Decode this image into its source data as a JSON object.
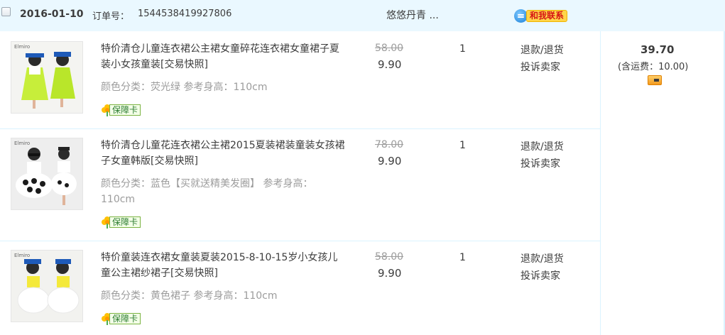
{
  "order": {
    "date": "2016-01-10",
    "order_no_label": "订单号：",
    "order_no": "1544538419927806",
    "shop_name": "悠悠丹青 ...",
    "contact_label": "和我联系",
    "total": "39.70",
    "shipping": "(含运费：10.00)"
  },
  "items": [
    {
      "title": "特价清仓儿童连衣裙公主裙女童碎花连衣裙女童裙子夏装小女孩童装[交易快照]",
      "sku": "颜色分类：荧光绿  参考身高：110cm",
      "guarantee": "保障卡",
      "original_price": "58.00",
      "price": "9.90",
      "quantity": "1",
      "action_refund": "退款/退货",
      "action_complain": "投诉卖家"
    },
    {
      "title": "特价清仓儿童花连衣裙公主裙2015夏装裙装童装女孩裙子女童韩版[交易快照]",
      "sku": "颜色分类：蓝色【买就送精美发圈】  参考身高：110cm",
      "guarantee": "保障卡",
      "original_price": "78.00",
      "price": "9.90",
      "quantity": "1",
      "action_refund": "退款/退货",
      "action_complain": "投诉卖家"
    },
    {
      "title": "特价童装连衣裙女童装夏装2015-8-10-15岁小女孩儿童公主裙纱裙子[交易快照]",
      "sku": "颜色分类：黄色裙子  参考身高：110cm",
      "guarantee": "保障卡",
      "original_price": "58.00",
      "price": "9.90",
      "quantity": "1",
      "action_refund": "退款/退货",
      "action_complain": "投诉卖家"
    }
  ],
  "icons": {
    "checkbox": "checkbox-unchecked",
    "contact": "chat-bubble-icon",
    "guarantee": "flower-icon",
    "card": "credit-card-icon"
  },
  "colors": {
    "header_bg": "#eaf8ff",
    "divider": "#daf3ff",
    "muted_text": "#9c9c9c",
    "contact_badge": "#ffd54a"
  }
}
